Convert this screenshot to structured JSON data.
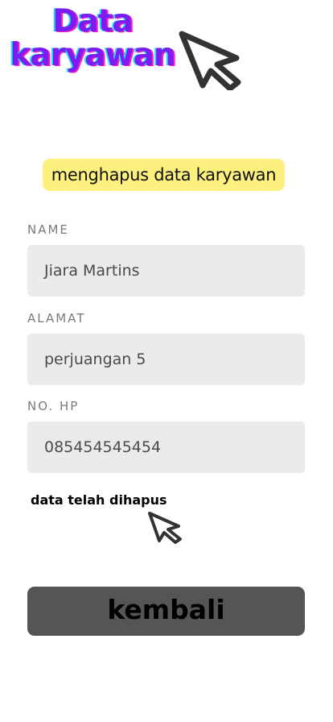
{
  "header": {
    "title_line1": "Data",
    "title_line2": "karyawan",
    "cursor_icon": "cursor-arrow-icon"
  },
  "subtitle": "menghapus data karyawan",
  "form": {
    "fields": [
      {
        "label": "NAME",
        "value": "Jiara Martins"
      },
      {
        "label": "ALAMAT",
        "value": "perjuangan 5"
      },
      {
        "label": "NO. HP",
        "value": "085454545454"
      }
    ]
  },
  "status": {
    "message": "data telah dihapus",
    "cursor_icon": "cursor-arrow-icon"
  },
  "actions": {
    "back_label": "kembali"
  },
  "colors": {
    "title": "#7c1cf2",
    "title_shadow_cyan": "#1fe3f2",
    "title_shadow_magenta": "#ff1fbf",
    "subtitle_highlight": "#fcf17e",
    "field_background": "#ebebeb",
    "button_background": "#555555"
  }
}
